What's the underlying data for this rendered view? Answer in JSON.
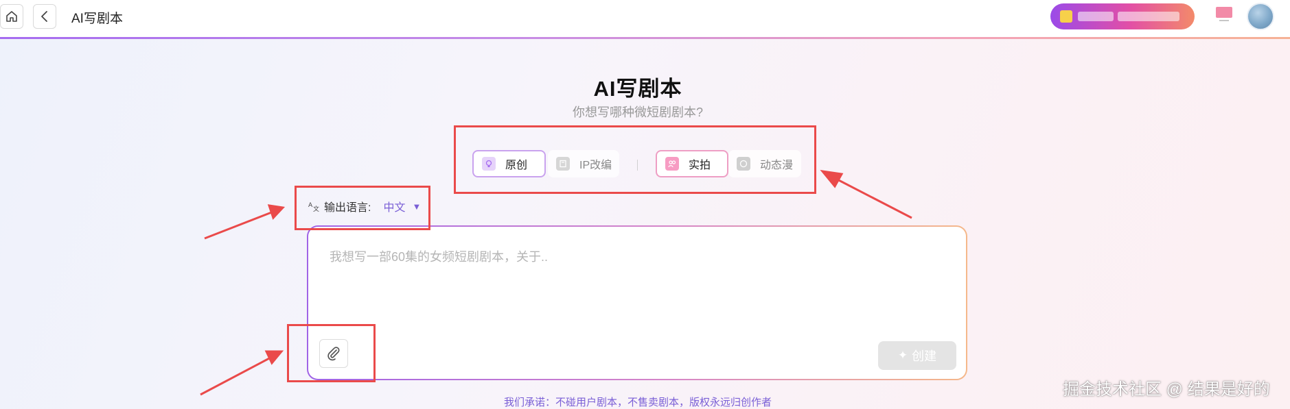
{
  "topbar": {
    "title": "AI写剧本",
    "promo_text": ""
  },
  "hero": {
    "title": "AI写剧本",
    "subtitle": "你想写哪种微短剧剧本?"
  },
  "types": {
    "group1": [
      {
        "label": "原创",
        "icon": "lightbulb-icon",
        "selected": true
      },
      {
        "label": "IP改编",
        "icon": "book-icon",
        "selected": false
      }
    ],
    "group2": [
      {
        "label": "实拍",
        "icon": "people-icon",
        "selected": true
      },
      {
        "label": "动态漫",
        "icon": "anime-icon",
        "selected": false
      }
    ]
  },
  "language": {
    "label": "输出语言:",
    "value": "中文",
    "caret": "▼"
  },
  "input": {
    "placeholder": "我想写一部60集的女频短剧剧本，关于.."
  },
  "buttons": {
    "create_label": "创建",
    "create_icon": "✦"
  },
  "footer": {
    "promise": "我们承诺：不碰用户剧本，不售卖剧本，版权永远归创作者"
  },
  "watermark": "掘金技术社区 @ 结果是好的",
  "colors": {
    "accent_purple": "#7a5fd6",
    "annotation_red": "#ea4a4a"
  }
}
